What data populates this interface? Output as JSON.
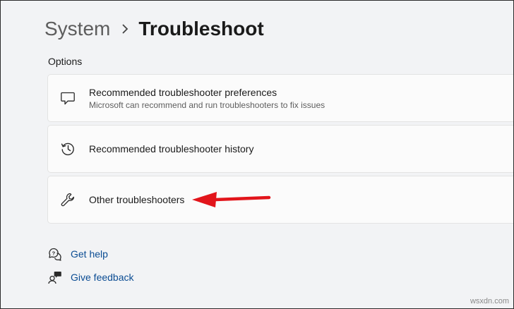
{
  "breadcrumb": {
    "parent": "System",
    "current": "Troubleshoot"
  },
  "options_heading": "Options",
  "cards": [
    {
      "label": "Recommended troubleshooter preferences",
      "description": "Microsoft can recommend and run troubleshooters to fix issues",
      "icon": "message-icon"
    },
    {
      "label": "Recommended troubleshooter history",
      "icon": "history-icon"
    },
    {
      "label": "Other troubleshooters",
      "icon": "wrench-icon"
    }
  ],
  "links": [
    {
      "label": "Get help",
      "icon": "help-icon"
    },
    {
      "label": "Give feedback",
      "icon": "feedback-icon"
    }
  ],
  "watermark": "wsxdn.com",
  "colors": {
    "link": "#0b4c93",
    "arrow": "#e2151b",
    "background": "#f2f3f5",
    "card": "#fbfbfb"
  }
}
